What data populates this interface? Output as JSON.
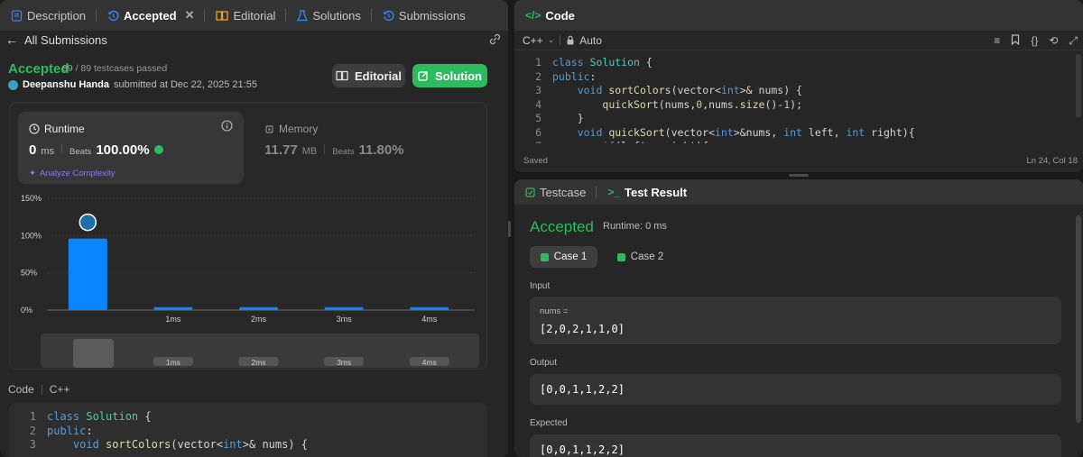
{
  "left_tabs": [
    {
      "label": "Description",
      "icon": "description-icon"
    },
    {
      "label": "Accepted",
      "icon": "history-icon"
    },
    {
      "label": "Editorial",
      "icon": "book-icon"
    },
    {
      "label": "Solutions",
      "icon": "flask-icon"
    },
    {
      "label": "Submissions",
      "icon": "history-icon"
    }
  ],
  "nav": {
    "back_label": "All Submissions"
  },
  "result": {
    "status": "Accepted",
    "testcases": "89 / 89 testcases passed",
    "user": "Deepanshu Handa",
    "submitted": "submitted at Dec 22, 2025 21:55"
  },
  "buttons": {
    "editorial": "Editorial",
    "solution": "Solution"
  },
  "runtime": {
    "label": "Runtime",
    "value": "0",
    "unit": "ms",
    "beats_label": "Beats",
    "beats_value": "100.00%",
    "analyze": "Analyze Complexity"
  },
  "memory": {
    "label": "Memory",
    "value": "11.77",
    "unit": "MB",
    "beats_label": "Beats",
    "beats_value": "11.80%"
  },
  "chart_data": {
    "type": "bar",
    "categories": [
      "",
      "1ms",
      "2ms",
      "3ms",
      "4ms"
    ],
    "values": [
      96,
      4,
      4,
      4,
      4
    ],
    "y_ticks": [
      "150%",
      "100%",
      "50%",
      "0%"
    ],
    "ylim": [
      0,
      150
    ],
    "minimap_labels": [
      "1ms",
      "2ms",
      "3ms",
      "4ms"
    ]
  },
  "bottom_code": {
    "header_code": "Code",
    "header_lang": "C++",
    "lines": [
      [
        {
          "t": "class ",
          "c": "kw"
        },
        {
          "t": "Solution",
          "c": "ty"
        },
        {
          "t": " {",
          "c": "pl"
        }
      ],
      [
        {
          "t": "public",
          "c": "kw"
        },
        {
          "t": ":",
          "c": "pl"
        }
      ],
      [
        {
          "t": "    ",
          "c": "pl"
        },
        {
          "t": "void ",
          "c": "kw"
        },
        {
          "t": "sortColors",
          "c": "fn"
        },
        {
          "t": "(vector<",
          "c": "pl"
        },
        {
          "t": "int",
          "c": "kw"
        },
        {
          "t": ">& nums) {",
          "c": "pl"
        }
      ]
    ]
  },
  "editor": {
    "title": "Code",
    "language": "C++",
    "mode": "Auto",
    "status": "Saved",
    "cursor": "Ln 24, Col 18",
    "lines": [
      [
        {
          "t": "class ",
          "c": "kw"
        },
        {
          "t": "Solution",
          "c": "ty"
        },
        {
          "t": " {",
          "c": "pl"
        }
      ],
      [
        {
          "t": "public",
          "c": "kw"
        },
        {
          "t": ":",
          "c": "pl"
        }
      ],
      [
        {
          "t": "    ",
          "c": "pl"
        },
        {
          "t": "void ",
          "c": "kw"
        },
        {
          "t": "sortColors",
          "c": "fn"
        },
        {
          "t": "(vector<",
          "c": "pl"
        },
        {
          "t": "int",
          "c": "kw"
        },
        {
          "t": ">& nums) {",
          "c": "pl"
        }
      ],
      [
        {
          "t": "        ",
          "c": "pl"
        },
        {
          "t": "quickSort",
          "c": "fn"
        },
        {
          "t": "(nums,",
          "c": "pl"
        },
        {
          "t": "0",
          "c": "nm"
        },
        {
          "t": ",nums.",
          "c": "pl"
        },
        {
          "t": "size",
          "c": "fn"
        },
        {
          "t": "()-",
          "c": "pl"
        },
        {
          "t": "1",
          "c": "nm"
        },
        {
          "t": ");",
          "c": "pl"
        }
      ],
      [
        {
          "t": "    }",
          "c": "pl"
        }
      ],
      [
        {
          "t": "    ",
          "c": "pl"
        },
        {
          "t": "void ",
          "c": "kw"
        },
        {
          "t": "quickSort",
          "c": "fn"
        },
        {
          "t": "(vector<",
          "c": "pl"
        },
        {
          "t": "int",
          "c": "kw"
        },
        {
          "t": ">&nums, ",
          "c": "pl"
        },
        {
          "t": "int ",
          "c": "kw"
        },
        {
          "t": "left, ",
          "c": "pl"
        },
        {
          "t": "int ",
          "c": "kw"
        },
        {
          "t": "right){",
          "c": "pl"
        }
      ],
      [
        {
          "t": "        ",
          "c": "pl"
        },
        {
          "t": "if",
          "c": "kw"
        },
        {
          "t": "(left < right){",
          "c": "pl"
        }
      ]
    ]
  },
  "test_panel": {
    "tab_testcase": "Testcase",
    "tab_result": "Test Result",
    "status": "Accepted",
    "runtime": "Runtime: 0 ms",
    "cases": [
      "Case 1",
      "Case 2"
    ],
    "input_label": "Input",
    "input_var": "nums =",
    "input_value": "[2,0,2,1,1,0]",
    "output_label": "Output",
    "output_value": "[0,0,1,1,2,2]",
    "expected_label": "Expected",
    "expected_value": "[0,0,1,1,2,2]"
  },
  "colors": {
    "accent_green": "#2cbb5d",
    "bar_blue": "#0a84ff",
    "header_bg": "#333333",
    "panel_bg": "#262626"
  }
}
